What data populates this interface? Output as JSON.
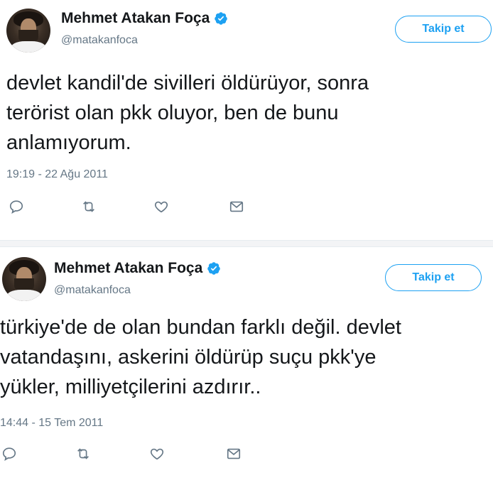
{
  "tweets": [
    {
      "display_name": "Mehmet Atakan Foça",
      "handle": "@matakanfoca",
      "follow_label": "Takip et",
      "text_lines": [
        "devlet kandil'de sivilleri öldürüyor, sonra",
        "terörist olan pkk oluyor, ben de bunu",
        "anlamıyorum."
      ],
      "timestamp": "19:19 - 22 Ağu 2011"
    },
    {
      "display_name": "Mehmet Atakan Foça",
      "handle": "@matakanfoca",
      "follow_label": "Takip et",
      "text_lines": [
        "türkiye'de de olan bundan farklı değil. devlet",
        "vatandaşını, askerini öldürüp suçu pkk'ye",
        "yükler, milliyetçilerini azdırır.."
      ],
      "timestamp": "14:44 - 15 Tem 2011"
    }
  ],
  "colors": {
    "accent": "#1da1f2",
    "text": "#14171a",
    "muted": "#657786",
    "separator": "#f3f4f6"
  },
  "icons": [
    "reply-icon",
    "retweet-icon",
    "like-icon",
    "direct-message-icon",
    "verified-badge-icon"
  ]
}
